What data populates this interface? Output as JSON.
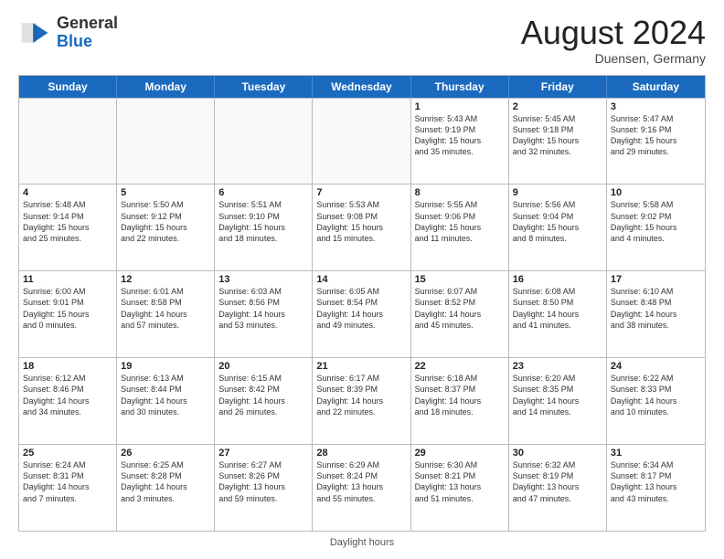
{
  "header": {
    "logo_general": "General",
    "logo_blue": "Blue",
    "month_title": "August 2024",
    "location": "Duensen, Germany"
  },
  "days_of_week": [
    "Sunday",
    "Monday",
    "Tuesday",
    "Wednesday",
    "Thursday",
    "Friday",
    "Saturday"
  ],
  "weeks": [
    [
      {
        "day": "",
        "info": "",
        "empty": true
      },
      {
        "day": "",
        "info": "",
        "empty": true
      },
      {
        "day": "",
        "info": "",
        "empty": true
      },
      {
        "day": "",
        "info": "",
        "empty": true
      },
      {
        "day": "1",
        "info": "Sunrise: 5:43 AM\nSunset: 9:19 PM\nDaylight: 15 hours\nand 35 minutes.",
        "empty": false
      },
      {
        "day": "2",
        "info": "Sunrise: 5:45 AM\nSunset: 9:18 PM\nDaylight: 15 hours\nand 32 minutes.",
        "empty": false
      },
      {
        "day": "3",
        "info": "Sunrise: 5:47 AM\nSunset: 9:16 PM\nDaylight: 15 hours\nand 29 minutes.",
        "empty": false
      }
    ],
    [
      {
        "day": "4",
        "info": "Sunrise: 5:48 AM\nSunset: 9:14 PM\nDaylight: 15 hours\nand 25 minutes.",
        "empty": false
      },
      {
        "day": "5",
        "info": "Sunrise: 5:50 AM\nSunset: 9:12 PM\nDaylight: 15 hours\nand 22 minutes.",
        "empty": false
      },
      {
        "day": "6",
        "info": "Sunrise: 5:51 AM\nSunset: 9:10 PM\nDaylight: 15 hours\nand 18 minutes.",
        "empty": false
      },
      {
        "day": "7",
        "info": "Sunrise: 5:53 AM\nSunset: 9:08 PM\nDaylight: 15 hours\nand 15 minutes.",
        "empty": false
      },
      {
        "day": "8",
        "info": "Sunrise: 5:55 AM\nSunset: 9:06 PM\nDaylight: 15 hours\nand 11 minutes.",
        "empty": false
      },
      {
        "day": "9",
        "info": "Sunrise: 5:56 AM\nSunset: 9:04 PM\nDaylight: 15 hours\nand 8 minutes.",
        "empty": false
      },
      {
        "day": "10",
        "info": "Sunrise: 5:58 AM\nSunset: 9:02 PM\nDaylight: 15 hours\nand 4 minutes.",
        "empty": false
      }
    ],
    [
      {
        "day": "11",
        "info": "Sunrise: 6:00 AM\nSunset: 9:01 PM\nDaylight: 15 hours\nand 0 minutes.",
        "empty": false
      },
      {
        "day": "12",
        "info": "Sunrise: 6:01 AM\nSunset: 8:58 PM\nDaylight: 14 hours\nand 57 minutes.",
        "empty": false
      },
      {
        "day": "13",
        "info": "Sunrise: 6:03 AM\nSunset: 8:56 PM\nDaylight: 14 hours\nand 53 minutes.",
        "empty": false
      },
      {
        "day": "14",
        "info": "Sunrise: 6:05 AM\nSunset: 8:54 PM\nDaylight: 14 hours\nand 49 minutes.",
        "empty": false
      },
      {
        "day": "15",
        "info": "Sunrise: 6:07 AM\nSunset: 8:52 PM\nDaylight: 14 hours\nand 45 minutes.",
        "empty": false
      },
      {
        "day": "16",
        "info": "Sunrise: 6:08 AM\nSunset: 8:50 PM\nDaylight: 14 hours\nand 41 minutes.",
        "empty": false
      },
      {
        "day": "17",
        "info": "Sunrise: 6:10 AM\nSunset: 8:48 PM\nDaylight: 14 hours\nand 38 minutes.",
        "empty": false
      }
    ],
    [
      {
        "day": "18",
        "info": "Sunrise: 6:12 AM\nSunset: 8:46 PM\nDaylight: 14 hours\nand 34 minutes.",
        "empty": false
      },
      {
        "day": "19",
        "info": "Sunrise: 6:13 AM\nSunset: 8:44 PM\nDaylight: 14 hours\nand 30 minutes.",
        "empty": false
      },
      {
        "day": "20",
        "info": "Sunrise: 6:15 AM\nSunset: 8:42 PM\nDaylight: 14 hours\nand 26 minutes.",
        "empty": false
      },
      {
        "day": "21",
        "info": "Sunrise: 6:17 AM\nSunset: 8:39 PM\nDaylight: 14 hours\nand 22 minutes.",
        "empty": false
      },
      {
        "day": "22",
        "info": "Sunrise: 6:18 AM\nSunset: 8:37 PM\nDaylight: 14 hours\nand 18 minutes.",
        "empty": false
      },
      {
        "day": "23",
        "info": "Sunrise: 6:20 AM\nSunset: 8:35 PM\nDaylight: 14 hours\nand 14 minutes.",
        "empty": false
      },
      {
        "day": "24",
        "info": "Sunrise: 6:22 AM\nSunset: 8:33 PM\nDaylight: 14 hours\nand 10 minutes.",
        "empty": false
      }
    ],
    [
      {
        "day": "25",
        "info": "Sunrise: 6:24 AM\nSunset: 8:31 PM\nDaylight: 14 hours\nand 7 minutes.",
        "empty": false
      },
      {
        "day": "26",
        "info": "Sunrise: 6:25 AM\nSunset: 8:28 PM\nDaylight: 14 hours\nand 3 minutes.",
        "empty": false
      },
      {
        "day": "27",
        "info": "Sunrise: 6:27 AM\nSunset: 8:26 PM\nDaylight: 13 hours\nand 59 minutes.",
        "empty": false
      },
      {
        "day": "28",
        "info": "Sunrise: 6:29 AM\nSunset: 8:24 PM\nDaylight: 13 hours\nand 55 minutes.",
        "empty": false
      },
      {
        "day": "29",
        "info": "Sunrise: 6:30 AM\nSunset: 8:21 PM\nDaylight: 13 hours\nand 51 minutes.",
        "empty": false
      },
      {
        "day": "30",
        "info": "Sunrise: 6:32 AM\nSunset: 8:19 PM\nDaylight: 13 hours\nand 47 minutes.",
        "empty": false
      },
      {
        "day": "31",
        "info": "Sunrise: 6:34 AM\nSunset: 8:17 PM\nDaylight: 13 hours\nand 43 minutes.",
        "empty": false
      }
    ]
  ],
  "footer": {
    "daylight_label": "Daylight hours"
  }
}
